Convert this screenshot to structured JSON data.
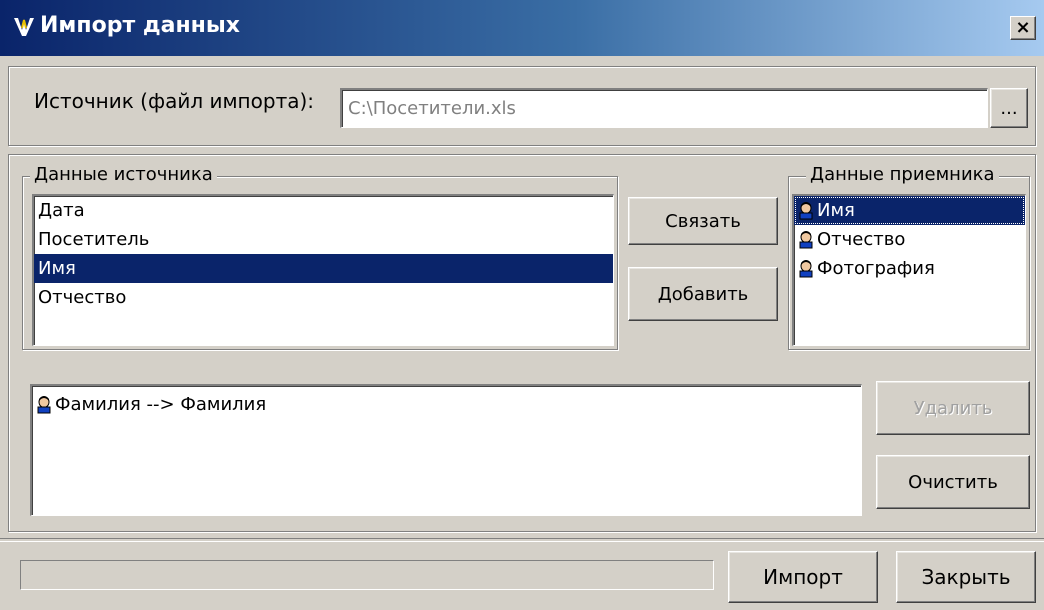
{
  "window": {
    "title": "Импорт данных",
    "close_label": "×"
  },
  "source": {
    "label": "Источник (файл импорта):",
    "value": "C:\\Посетители.xls",
    "browse_label": "..."
  },
  "source_data": {
    "title": "Данные источника",
    "items": [
      "Дата",
      "Посетитель",
      "Имя",
      "Отчество"
    ],
    "selected_index": 2
  },
  "target_data": {
    "title": "Данные приемника",
    "items": [
      {
        "label": "Имя",
        "icon": "person-icon"
      },
      {
        "label": "Отчество",
        "icon": "person-icon"
      },
      {
        "label": "Фотография",
        "icon": "person-icon"
      }
    ],
    "selected_index": 0
  },
  "buttons": {
    "link": "Связать",
    "add": "Добавить",
    "delete": "Удалить",
    "clear": "Очистить",
    "import": "Импорт",
    "close": "Закрыть"
  },
  "links": {
    "items": [
      {
        "label": "Фамилия --> Фамилия",
        "icon": "person-icon"
      }
    ]
  },
  "progress": {
    "value": 0
  },
  "colors": {
    "selection": "#0a246a",
    "title_start": "#0a246a",
    "title_end": "#a6caf0",
    "face": "#d4d0c8"
  }
}
